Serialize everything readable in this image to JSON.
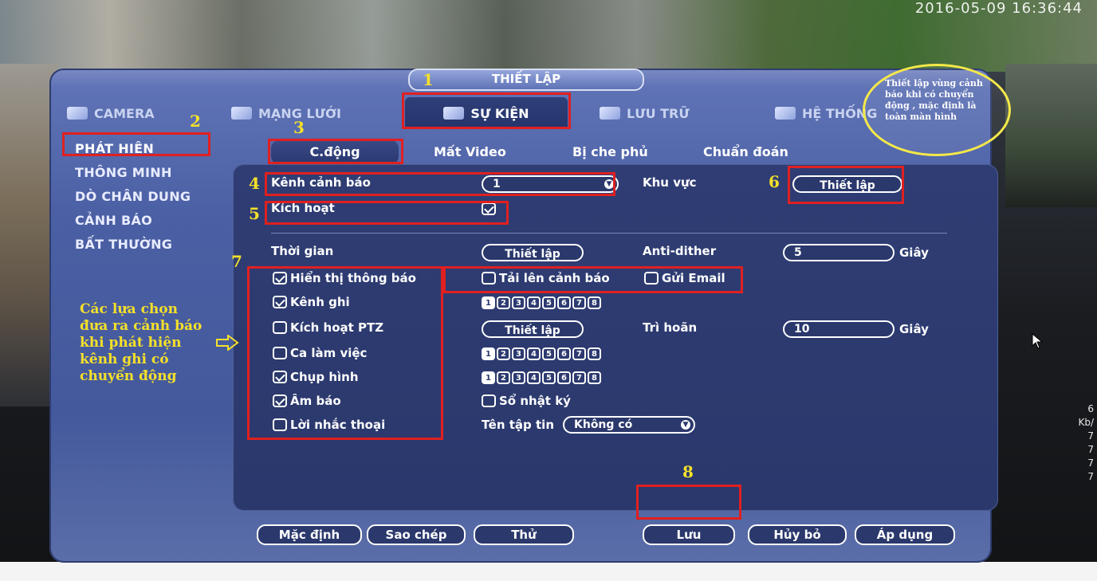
{
  "title": "THIẾT LẬP",
  "timestamp": "2016-05-09 16:36:44",
  "tabs": [
    {
      "label": "CAMERA"
    },
    {
      "label": "MẠNG LƯỚI"
    },
    {
      "label": "SỰ KIỆN"
    },
    {
      "label": "LƯU TRỮ"
    },
    {
      "label": "HỆ THỐNG"
    }
  ],
  "sidebar": {
    "items": [
      {
        "label": "PHÁT HIỆN"
      },
      {
        "label": "THÔNG MINH"
      },
      {
        "label": "DÒ CHÂN DUNG"
      },
      {
        "label": "CẢNH BÁO"
      },
      {
        "label": "BẤT THƯỜNG"
      }
    ]
  },
  "subtabs": [
    {
      "label": "C.động"
    },
    {
      "label": "Mất Video"
    },
    {
      "label": "Bị che phủ"
    },
    {
      "label": "Chuẩn đoán"
    }
  ],
  "form": {
    "channel_label": "Kênh cảnh báo",
    "channel_value": "1",
    "region_label": "Khu vực",
    "region_button": "Thiết lập",
    "enable_label": "Kích hoạt",
    "time_label": "Thời gian",
    "time_button": "Thiết lập",
    "antidither_label": "Anti-dither",
    "antidither_value": "5",
    "unit_seconds": "Giây",
    "show_message_label": "Hiển thị thông báo",
    "upload_alarm_label": "Tải lên cảnh báo",
    "send_email_label": "Gửi Email",
    "record_channel_label": "Kênh ghi",
    "ptz_label": "Kích hoạt PTZ",
    "ptz_button": "Thiết lập",
    "delay_label": "Trì hoãn",
    "delay_value": "10",
    "tour_label": "Ca làm việc",
    "snapshot_label": "Chụp hình",
    "buzzer_label": "Âm báo",
    "log_label": "Sổ nhật ký",
    "voice_label": "Lời nhắc thoại",
    "filename_label": "Tên tập tin",
    "filename_value": "Không có",
    "channels": [
      "1",
      "2",
      "3",
      "4",
      "5",
      "6",
      "7",
      "8"
    ]
  },
  "buttons": {
    "default": "Mặc định",
    "copy": "Sao chép",
    "test": "Thử",
    "save": "Lưu",
    "cancel": "Hủy bỏ",
    "apply": "Áp dụng"
  },
  "annotations": {
    "numbers": [
      "1",
      "2",
      "3",
      "4",
      "5",
      "6",
      "7",
      "8"
    ],
    "bubble": "Thiết lập vùng cảnh báo khi có chuyển động , mặc định là toàn màn hình",
    "left_note": "Các lựa chọn đưa ra cảnh báo khi phát hiện kênh ghi có chuyển động"
  },
  "side_stats": [
    "6",
    "Kb/",
    "7",
    "7",
    "7",
    "7"
  ],
  "colors": {
    "annotation_red": "#e02020",
    "annotation_yellow": "#f4e02a",
    "dialog_blue": "#44599c",
    "panel_navy": "#2a386c"
  }
}
